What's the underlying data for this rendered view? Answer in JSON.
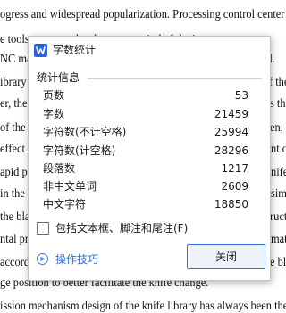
{
  "document": {
    "lines": [
      {
        "left": "ogress and widespread popularization. Processing control center",
        "right": ""
      },
      {
        "left": "e tools as a new development period of the important part c",
        "right": ""
      },
      {
        "left": "NC ma",
        "right": "sed."
      },
      {
        "left": "ibrary",
        "right": "f the"
      },
      {
        "left": "er, the",
        "right": "s the"
      },
      {
        "left": "of the",
        "right": "en, d"
      },
      {
        "left": "effect",
        "right": "nt du"
      },
      {
        "left": "apid pr",
        "right": "nife li"
      },
      {
        "left": "in the",
        "right": "simpl"
      },
      {
        "left": "the bla",
        "right": "ructur"
      },
      {
        "left": "ntal pro",
        "right": "matio"
      },
      {
        "left": "accord",
        "right": "e blac"
      },
      {
        "left": "ge position to better facilitate the knife change.",
        "right": ""
      },
      {
        "left": "ission mechanism design of the knife library has always been the k",
        "right": ""
      }
    ]
  },
  "dialog": {
    "title": "字数统计",
    "section_title": "统计信息",
    "stats": [
      {
        "label": "页数",
        "value": "53"
      },
      {
        "label": "字数",
        "value": "21459"
      },
      {
        "label": "字符数(不计空格)",
        "value": "25994"
      },
      {
        "label": "字符数(计空格)",
        "value": "28296"
      },
      {
        "label": "段落数",
        "value": "1217"
      },
      {
        "label": "非中文单词",
        "value": "2609"
      },
      {
        "label": "中文字符",
        "value": "18850"
      }
    ],
    "include_checkbox": {
      "label": "包括文本框、脚注和尾注(F)",
      "checked": false
    },
    "tips_label": "操作技巧",
    "close_label": "关闭"
  },
  "colors": {
    "accent": "#2f64d8",
    "link": "#2f6fd0"
  }
}
